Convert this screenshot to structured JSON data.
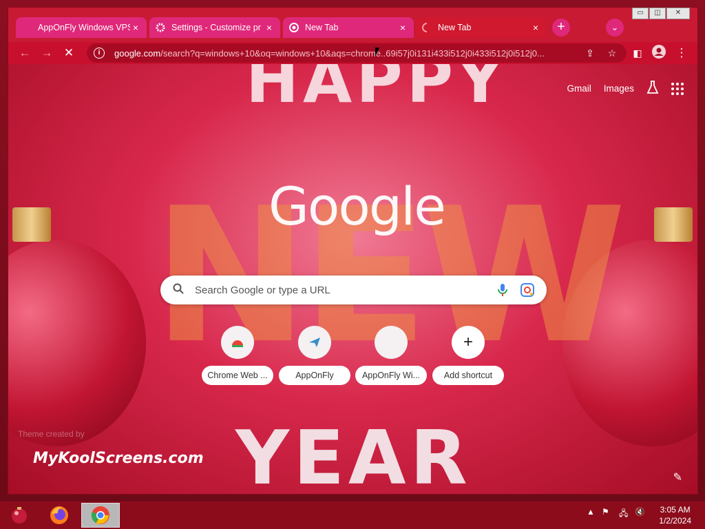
{
  "tabs": [
    {
      "title": "AppOnFly Windows VPS",
      "icon": "pink-square-icon",
      "close": "×"
    },
    {
      "title": "Settings - Customize pr",
      "icon": "gear-icon",
      "close": "×"
    },
    {
      "title": "New Tab",
      "icon": "chrome-icon",
      "close": "×"
    },
    {
      "title": "New Tab",
      "icon": "loading-spinner-icon",
      "close": "×"
    }
  ],
  "window_controls": {
    "minimize": "▭",
    "maximize": "◫",
    "close": "✕"
  },
  "toolbar": {
    "url_host": "google.com",
    "url_rest": "/search?q=windows+10&oq=windows+10&aqs=chrome..69i57j0i131i433i512j0i433i512j0i512j0..."
  },
  "topnav": {
    "gmail": "Gmail",
    "images": "Images"
  },
  "logo_text": "Google",
  "search": {
    "placeholder": "Search Google or type a URL"
  },
  "shortcuts": [
    {
      "label": "Chrome Web ...",
      "icon": "chrome-web-store-icon"
    },
    {
      "label": "AppOnFly",
      "icon": "paper-plane-icon"
    },
    {
      "label": "AppOnFly Wi...",
      "icon": "blank-site-icon"
    },
    {
      "label": "Add shortcut",
      "icon": "plus-icon"
    }
  ],
  "background_text": {
    "top": "HAPPY",
    "middle": "NEW",
    "bottom": "YEAR"
  },
  "theme_credit": "Theme created by",
  "watermark": "MyKoolScreens.com",
  "taskbar": {
    "time": "3:05 AM",
    "date": "1/2/2024"
  },
  "colors": {
    "accent": "#c8102e",
    "tab_inactive": "#e0287a",
    "taskbar": "#8c0c1c"
  }
}
